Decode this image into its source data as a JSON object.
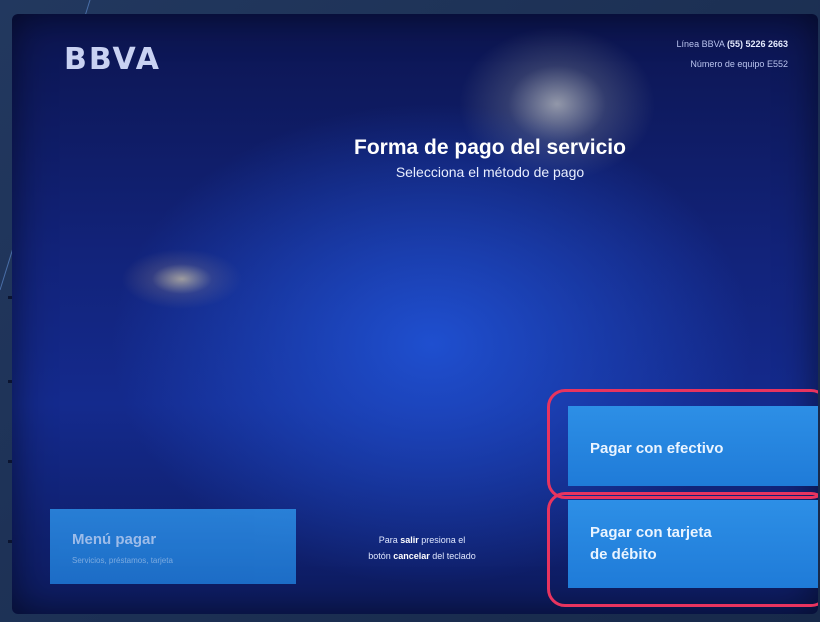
{
  "atm": {
    "brand": "BBVA",
    "hotline_label": "Línea BBVA",
    "hotline_number": "(55) 5226 2663",
    "terminal_label": "Número de equipo",
    "terminal_id": "E552"
  },
  "main": {
    "title": "Forma de pago del servicio",
    "subtitle": "Selecciona el método de pago"
  },
  "buttons": {
    "menu_title": "Menú pagar",
    "menu_subtitle": "Servicios, préstamos, tarjeta",
    "cash": "Pagar con efectivo",
    "debit_line1": "Pagar con tarjeta",
    "debit_line2": "de débito"
  },
  "hint": {
    "part1": "Para ",
    "salir": "salir",
    "part2": " presiona el",
    "part3": "botón ",
    "cancelar": "cancelar",
    "part4": " del teclado"
  },
  "colors": {
    "screen_blue": "#142a8d",
    "button_blue": "#2d8fe6",
    "highlight": "#e8345f"
  }
}
